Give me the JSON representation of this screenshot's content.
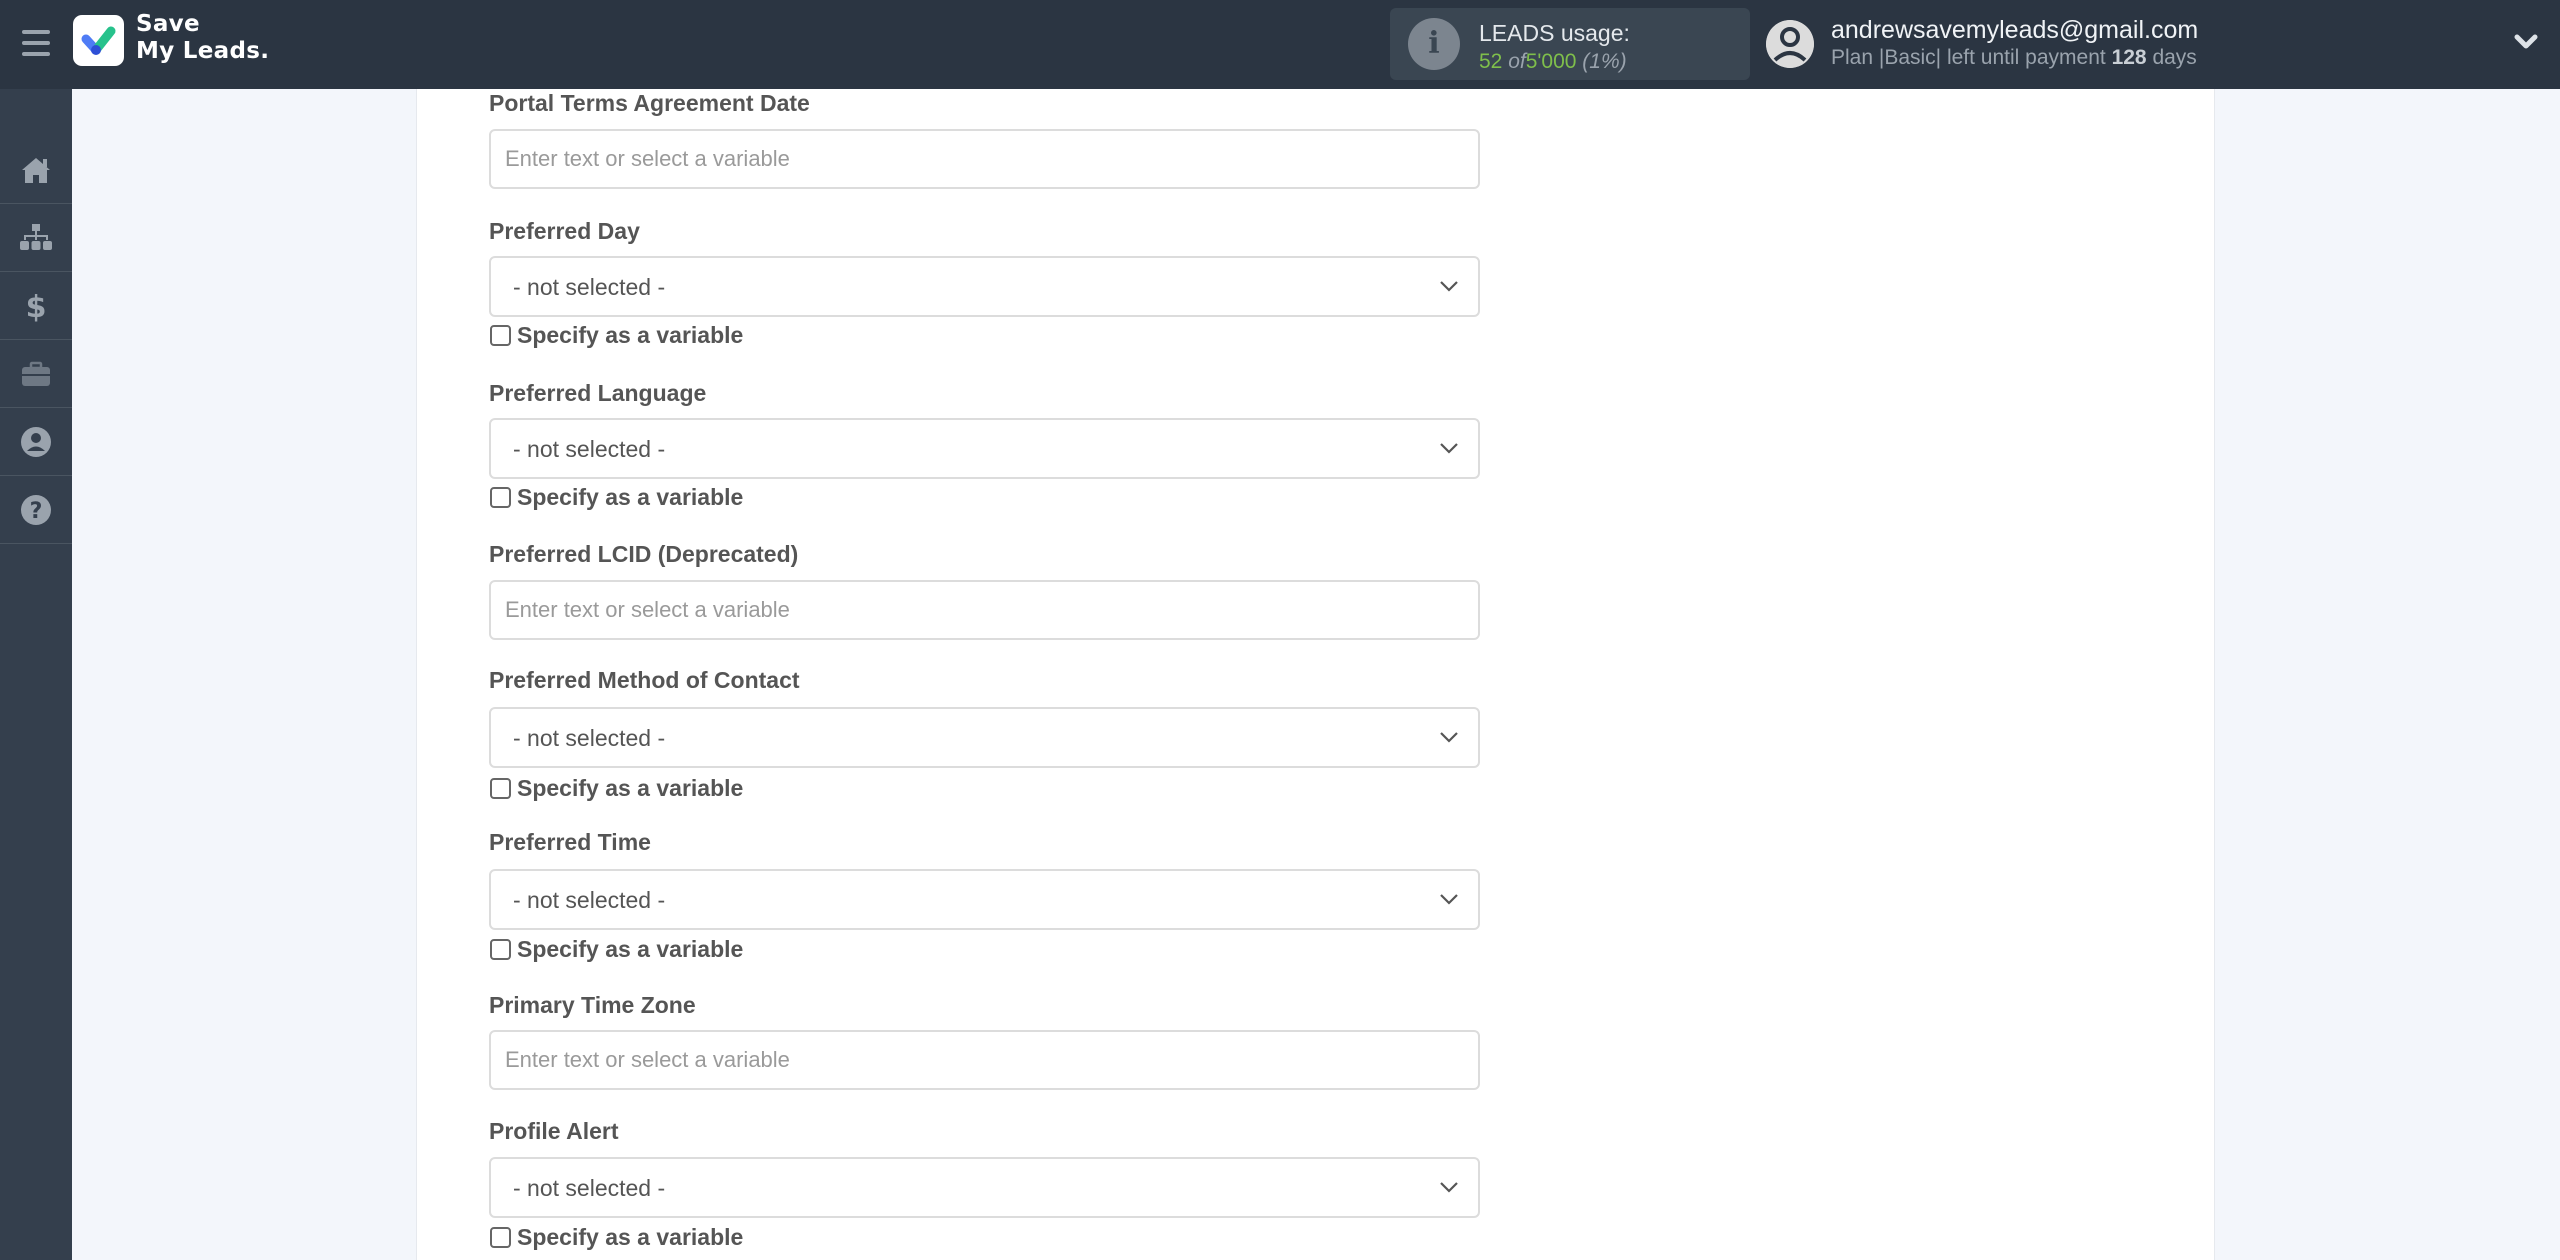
{
  "header": {
    "logo": {
      "line1": "Save",
      "line2": "My Leads."
    },
    "usage": {
      "title": "LEADS usage:",
      "used": "52",
      "of_label": "of",
      "limit": "5'000",
      "percent": "(1%)"
    },
    "user": {
      "email": "andrewsavemyleads@gmail.com",
      "plan_prefix": "Plan |Basic| left until payment",
      "days": "128",
      "days_suffix": "days"
    },
    "colors": {
      "header_bg": "#2b3542",
      "accent_green": "#7fbf4b"
    }
  },
  "sidebar": {
    "items": [
      {
        "name": "home",
        "icon": "home-icon"
      },
      {
        "name": "connections",
        "icon": "sitemap-icon"
      },
      {
        "name": "billing",
        "icon": "dollar-icon"
      },
      {
        "name": "tools",
        "icon": "briefcase-icon"
      },
      {
        "name": "account",
        "icon": "user-circle-icon"
      },
      {
        "name": "help",
        "icon": "question-circle-icon"
      }
    ]
  },
  "form": {
    "checkbox_label": "Specify as a variable",
    "input_placeholder": "Enter text or select a variable",
    "select_default": "- not selected -",
    "fields": [
      {
        "label": "Portal Terms Agreement Date",
        "type": "input",
        "value": ""
      },
      {
        "label": "Preferred Day",
        "type": "select",
        "value": "- not selected -",
        "specify_as_variable": false
      },
      {
        "label": "Preferred Language",
        "type": "select",
        "value": "- not selected -",
        "specify_as_variable": false
      },
      {
        "label": "Preferred LCID (Deprecated)",
        "type": "input",
        "value": ""
      },
      {
        "label": "Preferred Method of Contact",
        "type": "select",
        "value": "- not selected -",
        "specify_as_variable": false
      },
      {
        "label": "Preferred Time",
        "type": "select",
        "value": "- not selected -",
        "specify_as_variable": false
      },
      {
        "label": "Primary Time Zone",
        "type": "input",
        "value": ""
      },
      {
        "label": "Profile Alert",
        "type": "select",
        "value": "- not selected -",
        "specify_as_variable": false
      }
    ]
  }
}
